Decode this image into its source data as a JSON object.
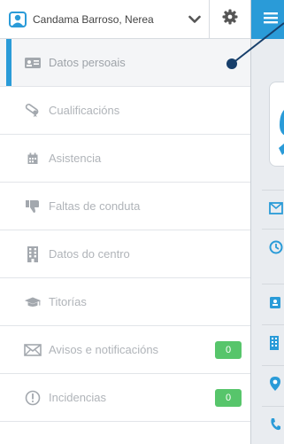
{
  "user": {
    "name": "Candama Barroso, Nerea"
  },
  "menu": {
    "items": [
      {
        "label": "Datos persoais",
        "icon": "id-card-icon",
        "active": true
      },
      {
        "label": "Cualificacións",
        "icon": "diploma-icon"
      },
      {
        "label": "Asistencia",
        "icon": "calendar-icon"
      },
      {
        "label": "Faltas de conduta",
        "icon": "thumbs-down-icon"
      },
      {
        "label": "Datos do centro",
        "icon": "building-icon"
      },
      {
        "label": "Titorías",
        "icon": "graduation-cap-icon"
      },
      {
        "label": "Avisos e notificacións",
        "icon": "envelope-icon",
        "badge": "0"
      },
      {
        "label": "Incidencias",
        "icon": "alert-circle-icon",
        "badge": "0"
      }
    ]
  },
  "colors": {
    "accent": "#2a9bd8",
    "badge": "#57c56b",
    "pointer": "#173f6b"
  }
}
